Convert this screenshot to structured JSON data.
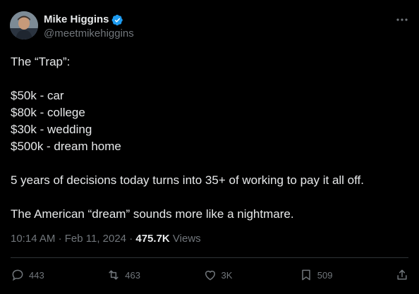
{
  "author": {
    "display_name": "Mike Higgins",
    "handle": "@meetmikehiggins",
    "verified": true
  },
  "tweet": {
    "text": "The “Trap”:\n\n$50k - car\n$80k - college\n$30k - wedding\n$500k - dream home\n\n5 years of decisions today turns into 35+ of working to pay it all off.\n\nThe American “dream” sounds more like a nightmare.",
    "time": "10:14 AM",
    "date": "Feb 11, 2024",
    "views_count": "475.7K",
    "views_label": "Views"
  },
  "actions": {
    "replies": "443",
    "reposts": "463",
    "likes": "3K",
    "bookmarks": "509"
  },
  "colors": {
    "background": "#000000",
    "text": "#e7e9ea",
    "muted": "#71767b",
    "verified": "#1d9bf0",
    "divider": "#2f3336"
  },
  "icons": [
    "verified-badge-icon",
    "more-icon",
    "reply-icon",
    "repost-icon",
    "like-icon",
    "bookmark-icon",
    "share-icon"
  ]
}
